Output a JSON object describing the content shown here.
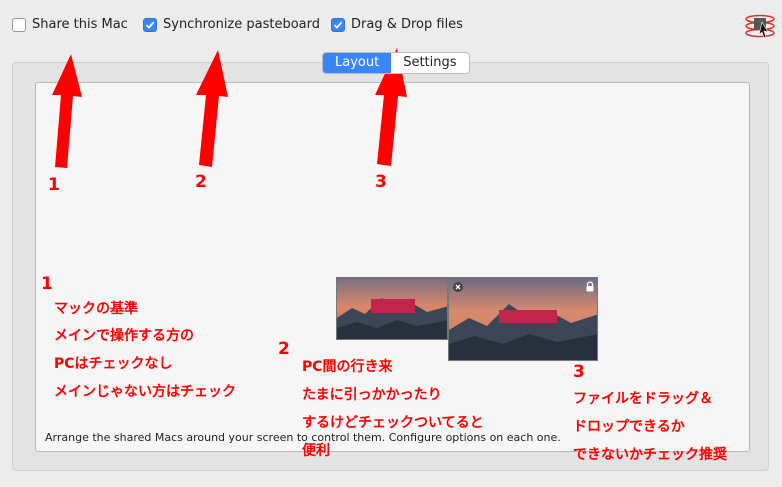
{
  "toolbar": {
    "share_label": "Share this Mac",
    "share_checked": false,
    "sync_label": "Synchronize pasteboard",
    "sync_checked": true,
    "dragdrop_label": "Drag & Drop files",
    "dragdrop_checked": true
  },
  "tabs": [
    {
      "label": "Layout",
      "active": true
    },
    {
      "label": "Settings",
      "active": false
    }
  ],
  "layout": {
    "footer": "Arrange the shared Macs around your screen to control them. Configure options on each one."
  },
  "annotations": {
    "arrow1_number": "1",
    "arrow2_number": "2",
    "arrow3_number": "3",
    "note1": {
      "number": "1",
      "lines": [
        "マックの基準",
        "メインで操作する方の",
        "PCはチェックなし",
        "メインじゃない方はチェック"
      ]
    },
    "note2": {
      "number": "2",
      "lines": [
        "PC間の行き来",
        "たまに引っかかったり",
        "するけどチェックついてると",
        "便利"
      ]
    },
    "note3": {
      "number": "3",
      "lines": [
        "ファイルをドラッグ＆",
        "ドロップできるか",
        "できないかチェック推奨"
      ]
    }
  },
  "colors": {
    "accent": "#3b86f7",
    "annotation": "#ff0000",
    "mac_bar": "#c2254b"
  },
  "icons": {
    "app": "screen-sharing-icon",
    "close": "close-icon",
    "lock": "lock-icon"
  }
}
